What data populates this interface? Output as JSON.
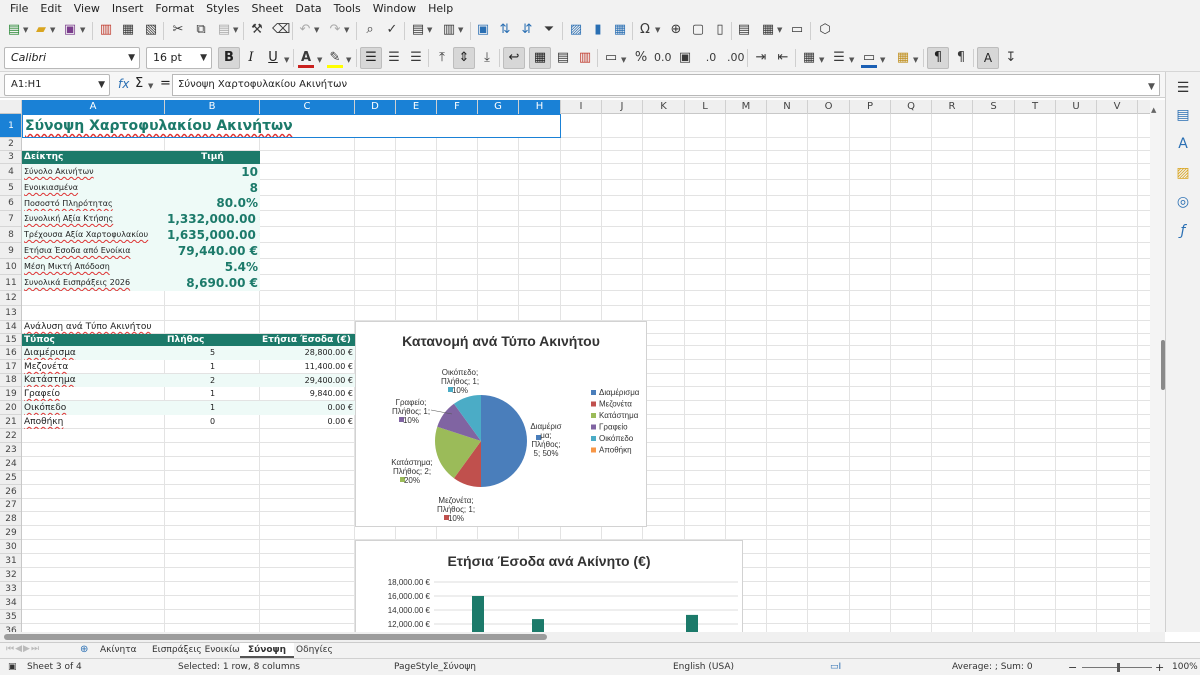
{
  "menu": [
    "File",
    "Edit",
    "View",
    "Insert",
    "Format",
    "Styles",
    "Sheet",
    "Data",
    "Tools",
    "Window",
    "Help"
  ],
  "toolbar": {
    "font_name": "Calibri",
    "font_size": "16 pt",
    "bold": "B",
    "italic": "I",
    "underline": "U"
  },
  "formula_bar": {
    "name_box": "A1:H1",
    "fx": "fx",
    "sigma": "Σ",
    "equals": "=",
    "content": "Σύνοψη Χαρτοφυλακίου Ακινήτων"
  },
  "columns": [
    "A",
    "B",
    "C",
    "D",
    "E",
    "F",
    "G",
    "H",
    "I",
    "J",
    "K",
    "L",
    "M",
    "N",
    "O",
    "P",
    "Q",
    "R",
    "S",
    "T",
    "U",
    "V"
  ],
  "rows": [
    "1",
    "2",
    "3",
    "4",
    "5",
    "6",
    "7",
    "8",
    "9",
    "10",
    "11",
    "12",
    "13",
    "14",
    "15",
    "16",
    "17",
    "18",
    "19",
    "20",
    "21",
    "22",
    "23",
    "24",
    "25",
    "26",
    "27",
    "28",
    "29",
    "30",
    "31",
    "32",
    "33",
    "34",
    "35",
    "36"
  ],
  "sheet": {
    "title": "Σύνοψη Χαρτοφυλακίου Ακινήτων",
    "kpi_header": {
      "label": "Δείκτης",
      "value": "Τιμή"
    },
    "kpis": [
      {
        "label": "Σύνολο Ακινήτων",
        "value": "10"
      },
      {
        "label": "Ενοικιασμένα",
        "value": "8"
      },
      {
        "label": "Ποσοστό Πληρότητας",
        "value": "80.0%"
      },
      {
        "label": "Συνολική Αξία Κτήσης",
        "value": "1,332,000.00 €"
      },
      {
        "label": "Τρέχουσα Αξία Χαρτοφυλακίου",
        "value": "1,635,000.00 €"
      },
      {
        "label": "Ετήσια Έσοδα από Ενοίκια",
        "value": "79,440.00 €"
      },
      {
        "label": "Μέση Μικτή Απόδοση",
        "value": "5.4%"
      },
      {
        "label": "Συνολικά Εισπράξεις 2026",
        "value": "8,690.00 €"
      }
    ],
    "analysis_title": "Ανάλυση ανά Τύπο Ακινήτου",
    "analysis_header": {
      "type": "Τύπος",
      "count": "Πλήθος",
      "income": "Ετήσια Έσοδα (€)"
    },
    "analysis_rows": [
      {
        "type": "Διαμέρισμα",
        "count": "5",
        "income": "28,800.00 €"
      },
      {
        "type": "Μεζονέτα",
        "count": "1",
        "income": "11,400.00 €"
      },
      {
        "type": "Κατάστημα",
        "count": "2",
        "income": "29,400.00 €"
      },
      {
        "type": "Γραφείο",
        "count": "1",
        "income": "9,840.00 €"
      },
      {
        "type": "Οικόπεδο",
        "count": "1",
        "income": "0.00 €"
      },
      {
        "type": "Αποθήκη",
        "count": "0",
        "income": "0.00 €"
      }
    ]
  },
  "chart_data": [
    {
      "type": "pie",
      "title": "Κατανομή ανά Τύπο Ακινήτου",
      "categories": [
        "Διαμέρισμα",
        "Μεζονέτα",
        "Κατάστημα",
        "Γραφείο",
        "Οικόπεδο",
        "Αποθήκη"
      ],
      "values": [
        5,
        1,
        2,
        1,
        1,
        0
      ],
      "colors": [
        "#4a7ebb",
        "#c0504d",
        "#9bbb59",
        "#8064a2",
        "#4bacc6",
        "#f79646"
      ],
      "data_labels": [
        [
          "Διαμέρισ",
          "μα;",
          "Πλήθος;",
          "5; 50%"
        ],
        [
          "Μεζονέτα;",
          "Πλήθος; 1;",
          "10%"
        ],
        [
          "Κατάστημα;",
          "Πλήθος; 2;",
          "20%"
        ],
        [
          "Γραφείο;",
          "Πλήθος; 1;",
          "10%"
        ],
        [
          "Οικόπεδο;",
          "Πλήθος; 1;",
          "10%"
        ]
      ],
      "legend_position": "right"
    },
    {
      "type": "bar",
      "title": "Ετήσια Έσοδα ανά Ακίνητο (€)",
      "y_ticks": [
        "18,000.00 €",
        "16,000.00 €",
        "14,000.00 €",
        "12,000.00 €"
      ],
      "ylim_visible": [
        12000,
        18000
      ],
      "visible_values": [
        16000,
        12700,
        13300
      ],
      "bar_color": "#1c7a6a",
      "grid": true
    }
  ],
  "sheet_tabs": [
    "Ακίνητα",
    "Εισπράξεις Ενοικίων",
    "Σύνοψη",
    "Οδηγίες"
  ],
  "active_tab": "Σύνοψη",
  "status": {
    "sheet": "Sheet 3 of 4",
    "selection": "Selected: 1 row, 8 columns",
    "page_style": "PageStyle_Σύνοψη",
    "language": "English (USA)",
    "summary": "Average: ; Sum: 0",
    "zoom": "100%"
  }
}
